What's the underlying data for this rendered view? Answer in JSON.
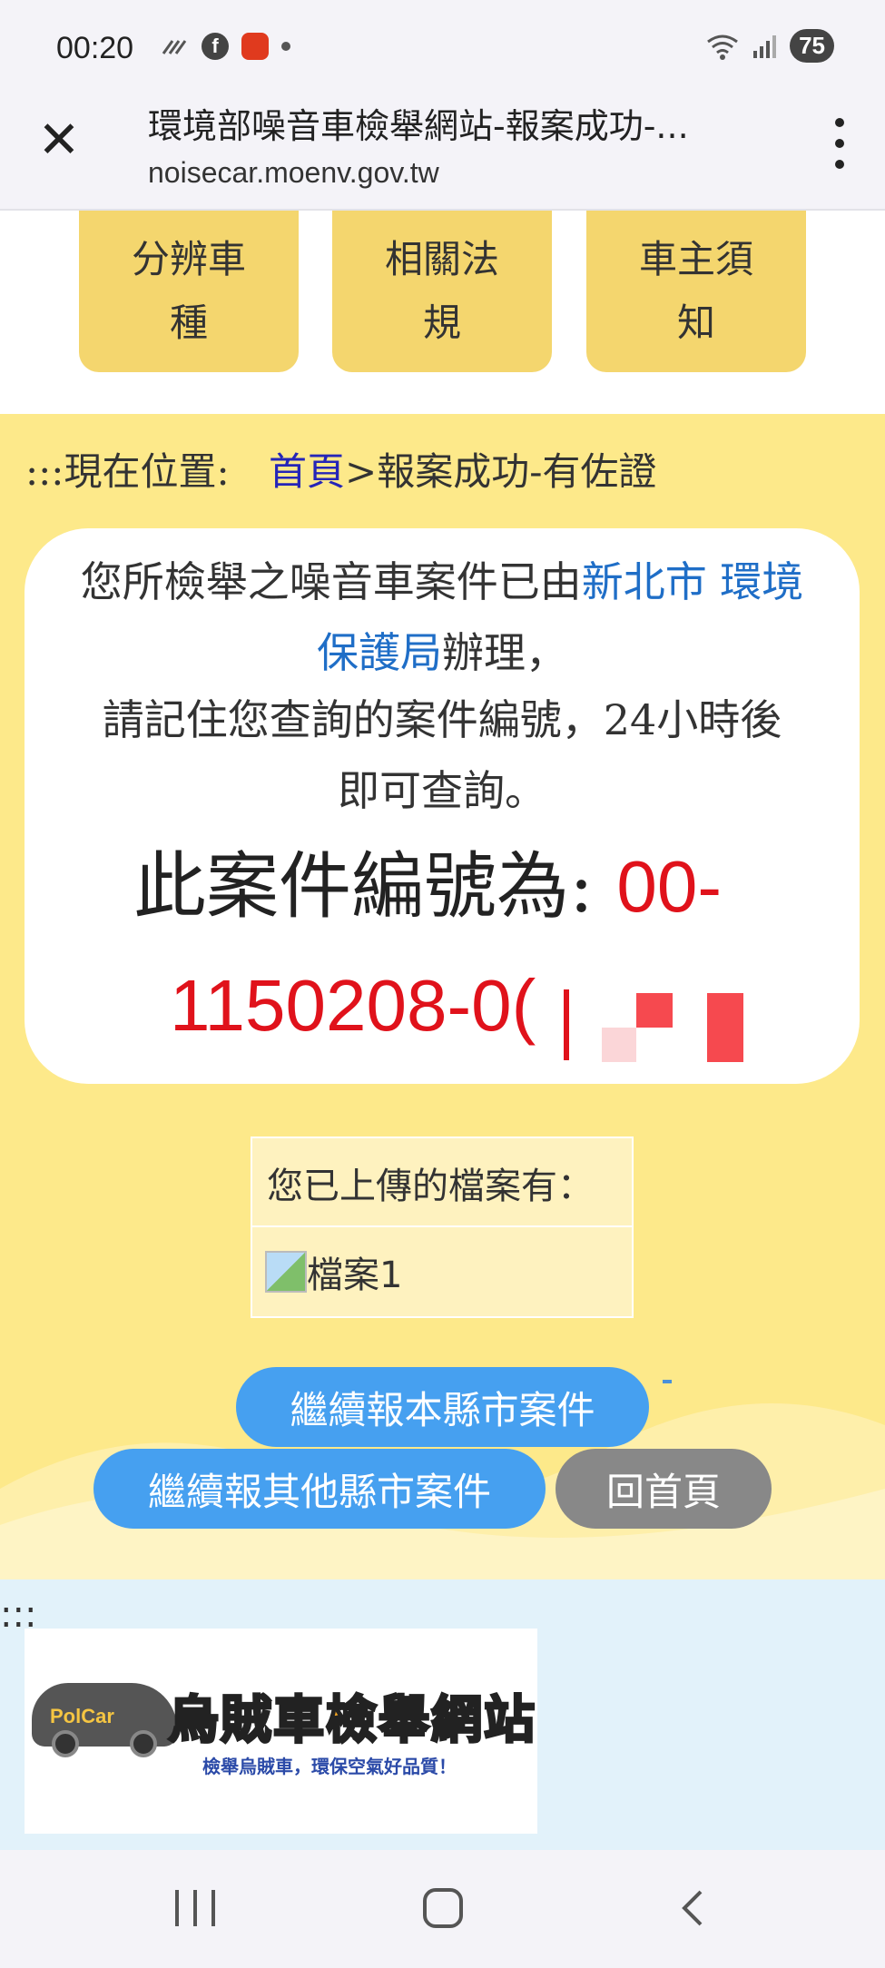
{
  "status_bar": {
    "time": "00:20",
    "signal_label": "5",
    "battery": "75"
  },
  "browser": {
    "title": "環境部噪音車檢舉網站-報案成功-...",
    "url": "noisecar.moenv.gov.tw"
  },
  "nav_buttons": [
    {
      "label": "分辨車種"
    },
    {
      "label": "相關法規"
    },
    {
      "label": "車主須知"
    }
  ],
  "breadcrumb": {
    "prefix": ":::現在位置:",
    "home": "首頁",
    "separator": ">",
    "current": "報案成功-有佐證"
  },
  "result": {
    "line1_before": "您所檢舉之噪音車案件已由",
    "agency": "新北市 環境保護局",
    "line1_after": "辦理，",
    "line2": "請記住您查詢的案件編號，24小時後即可查詢。",
    "case_label": "此案件編號為: ",
    "case_prefix": "00-",
    "case_number_visible": "1150208-0("
  },
  "uploads": {
    "heading": "您已上傳的檔案有：",
    "files": [
      {
        "name": "檔案1"
      }
    ]
  },
  "actions": {
    "continue_same_city": "繼續報本縣市案件",
    "continue_other_city": "繼續報其他縣市案件",
    "home": "回首頁"
  },
  "footer": {
    "dots": ":::",
    "logo_title": "烏賊車檢舉網站",
    "logo_badge": "PolCar",
    "logo_subtitle": "檢舉烏賊車，環保空氣好品質！"
  },
  "colors": {
    "page_bg": "#fde98a",
    "nav_button": "#f4d66e",
    "link_blue": "#2525b8",
    "agency_blue": "#1f6ec7",
    "case_red": "#e0121b",
    "action_blue": "#46a0f0",
    "action_gray": "#888888",
    "footer_bg": "#e2f2fa"
  }
}
